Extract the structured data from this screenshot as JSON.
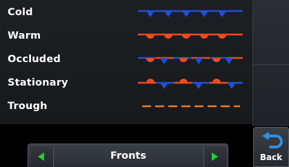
{
  "legend": {
    "items": [
      {
        "label": "Cold",
        "style": "cold"
      },
      {
        "label": "Warm",
        "style": "warm"
      },
      {
        "label": "Occluded",
        "style": "occluded"
      },
      {
        "label": "Stationary",
        "style": "stationary"
      },
      {
        "label": "Trough",
        "style": "trough"
      }
    ]
  },
  "selector": {
    "value": "Fronts"
  },
  "back_button": {
    "label": "Back"
  },
  "colors": {
    "cold": "#1f4fd8",
    "warm": "#f04a1c",
    "trough": "#f07d22",
    "arrow": "#1fd23a",
    "back_icon": "#2f8fe0"
  },
  "icons": {
    "prev": "triangle-left-icon",
    "next": "triangle-right-icon",
    "back": "curved-back-arrow-icon"
  }
}
